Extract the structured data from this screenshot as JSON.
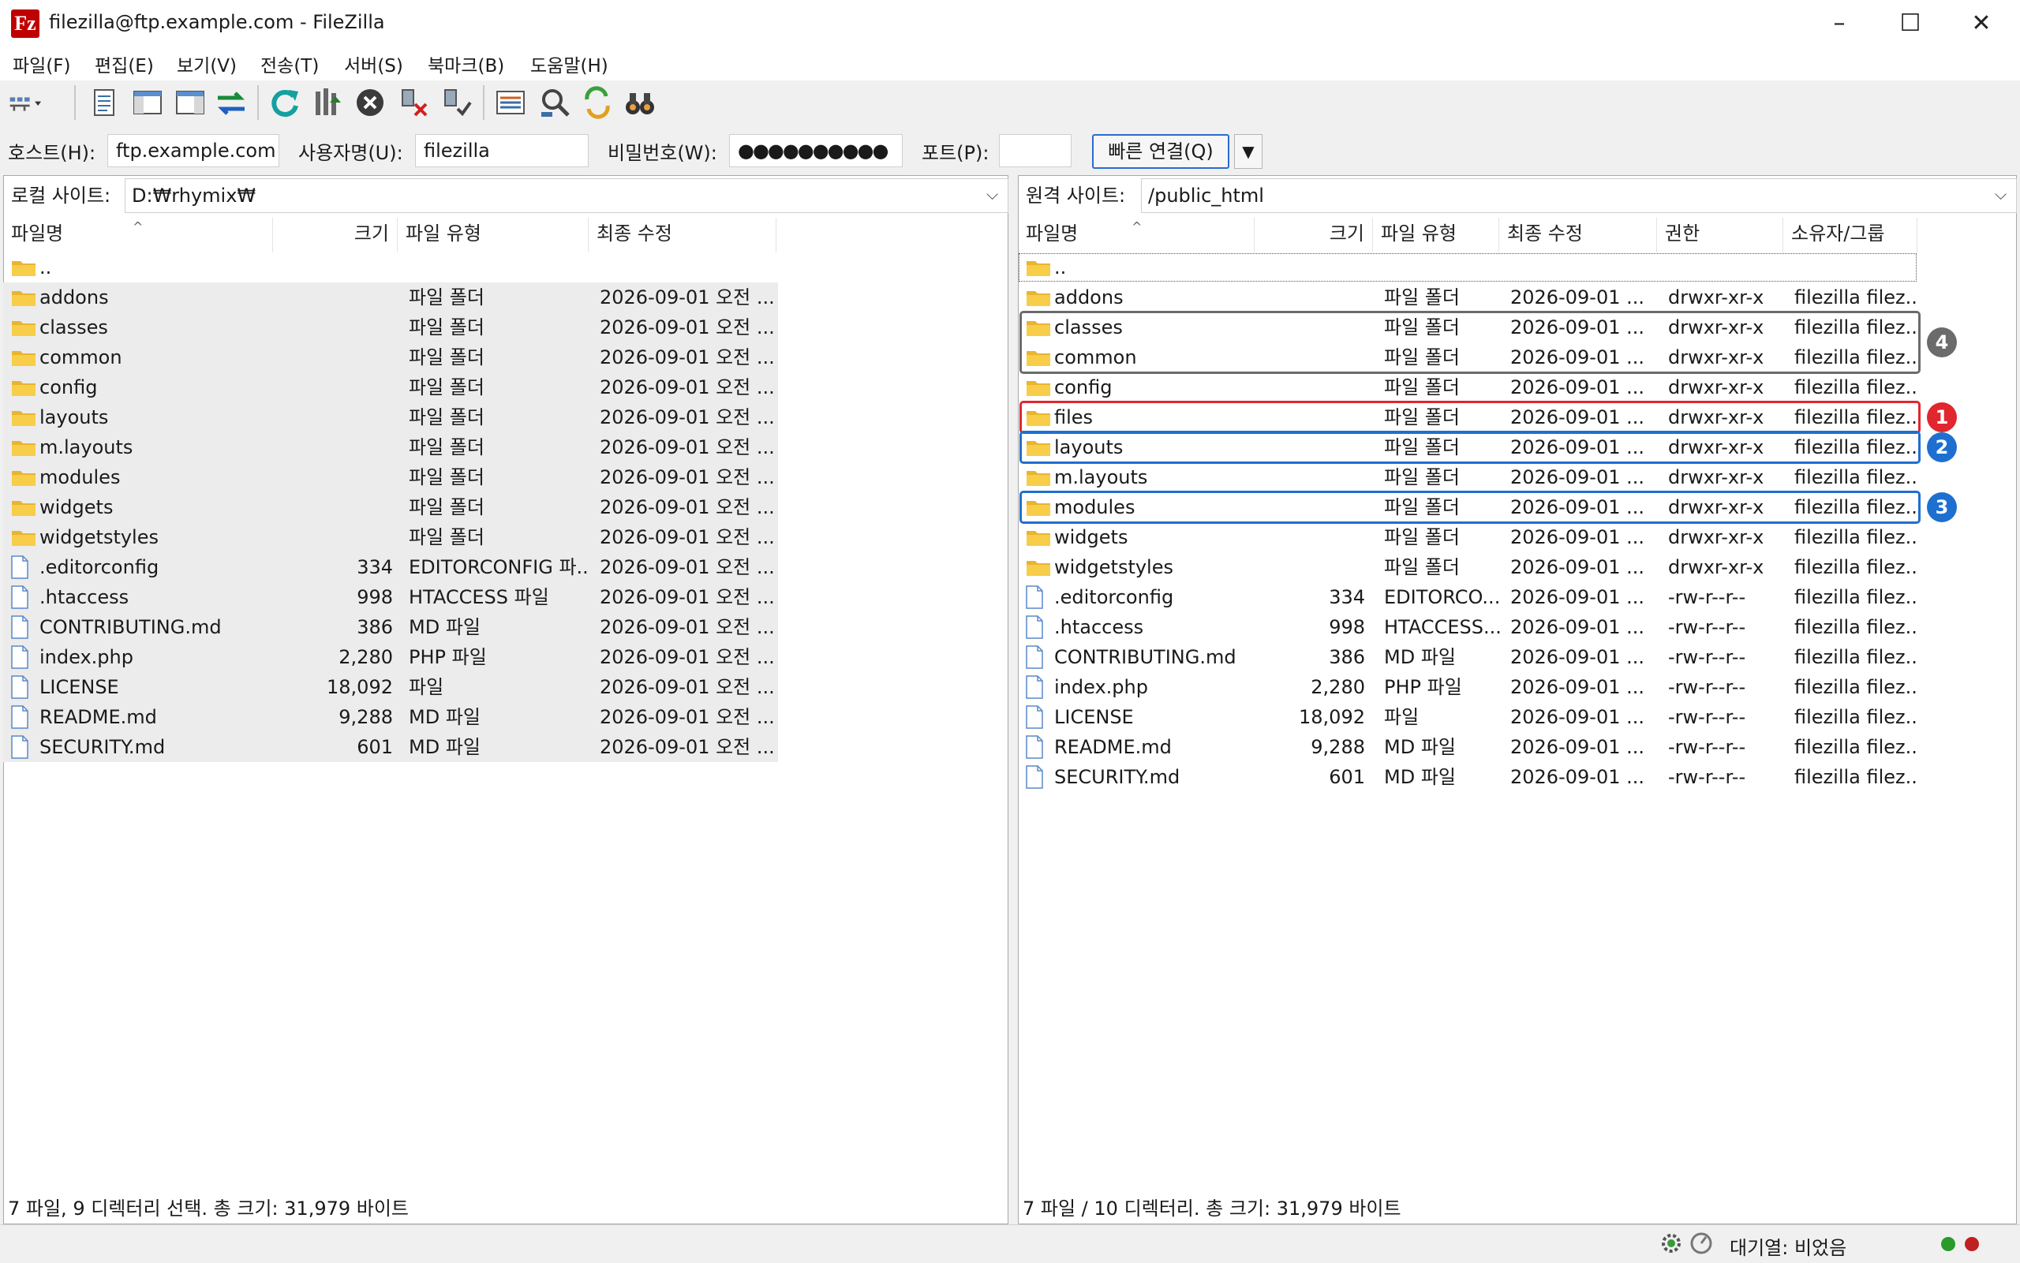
{
  "window": {
    "title": "filezilla@ftp.example.com - FileZilla",
    "app_icon": "Fz"
  },
  "menu": [
    "파일(F)",
    "편집(E)",
    "보기(V)",
    "전송(T)",
    "서버(S)",
    "북마크(B)",
    "도움말(H)"
  ],
  "toolbar": [
    "site-manager",
    "toggle-log",
    "toggle-local-tree",
    "toggle-remote-tree",
    "toggle-queue",
    "refresh",
    "process-queue",
    "cancel",
    "disconnect",
    "reconnect",
    "directory-listing-filters",
    "directory-comparison",
    "synchronized-browsing",
    "search"
  ],
  "quickconnect": {
    "host_label": "호스트(H):",
    "host_value": "ftp.example.com",
    "user_label": "사용자명(U):",
    "user_value": "filezilla",
    "pass_label": "비밀번호(W):",
    "pass_value": "●●●●●●●●●●",
    "port_label": "포트(P):",
    "port_value": "",
    "button": "빠른 연결(Q)",
    "dropdown": "▼"
  },
  "local": {
    "site_label": "로컬 사이트:",
    "path": "D:₩rhymix₩",
    "columns": [
      "파일명",
      "크기",
      "파일 유형",
      "최종 수정"
    ],
    "rows": [
      {
        "name": "..",
        "size": "",
        "type": "",
        "modified": "",
        "kind": "folder"
      },
      {
        "name": "addons",
        "size": "",
        "type": "파일 폴더",
        "modified": "2026-09-01 오전 ...",
        "kind": "folder"
      },
      {
        "name": "classes",
        "size": "",
        "type": "파일 폴더",
        "modified": "2026-09-01 오전 ...",
        "kind": "folder"
      },
      {
        "name": "common",
        "size": "",
        "type": "파일 폴더",
        "modified": "2026-09-01 오전 ...",
        "kind": "folder"
      },
      {
        "name": "config",
        "size": "",
        "type": "파일 폴더",
        "modified": "2026-09-01 오전 ...",
        "kind": "folder"
      },
      {
        "name": "layouts",
        "size": "",
        "type": "파일 폴더",
        "modified": "2026-09-01 오전 ...",
        "kind": "folder"
      },
      {
        "name": "m.layouts",
        "size": "",
        "type": "파일 폴더",
        "modified": "2026-09-01 오전 ...",
        "kind": "folder"
      },
      {
        "name": "modules",
        "size": "",
        "type": "파일 폴더",
        "modified": "2026-09-01 오전 ...",
        "kind": "folder"
      },
      {
        "name": "widgets",
        "size": "",
        "type": "파일 폴더",
        "modified": "2026-09-01 오전 ...",
        "kind": "folder"
      },
      {
        "name": "widgetstyles",
        "size": "",
        "type": "파일 폴더",
        "modified": "2026-09-01 오전 ...",
        "kind": "folder"
      },
      {
        "name": ".editorconfig",
        "size": "334",
        "type": "EDITORCONFIG 파...",
        "modified": "2026-09-01 오전 ...",
        "kind": "file"
      },
      {
        "name": ".htaccess",
        "size": "998",
        "type": "HTACCESS 파일",
        "modified": "2026-09-01 오전 ...",
        "kind": "file"
      },
      {
        "name": "CONTRIBUTING.md",
        "size": "386",
        "type": "MD 파일",
        "modified": "2026-09-01 오전 ...",
        "kind": "file"
      },
      {
        "name": "index.php",
        "size": "2,280",
        "type": "PHP 파일",
        "modified": "2026-09-01 오전 ...",
        "kind": "file"
      },
      {
        "name": "LICENSE",
        "size": "18,092",
        "type": "파일",
        "modified": "2026-09-01 오전 ...",
        "kind": "file"
      },
      {
        "name": "README.md",
        "size": "9,288",
        "type": "MD 파일",
        "modified": "2026-09-01 오전 ...",
        "kind": "file"
      },
      {
        "name": "SECURITY.md",
        "size": "601",
        "type": "MD 파일",
        "modified": "2026-09-01 오전 ...",
        "kind": "file"
      }
    ],
    "status": "7 파일, 9 디렉터리 선택. 총 크기: 31,979 바이트"
  },
  "remote": {
    "site_label": "원격 사이트:",
    "path": "/public_html",
    "columns": [
      "파일명",
      "크기",
      "파일 유형",
      "최종 수정",
      "권한",
      "소유자/그룹"
    ],
    "rows": [
      {
        "name": "..",
        "size": "",
        "type": "",
        "modified": "",
        "perm": "",
        "owner": "",
        "kind": "folder"
      },
      {
        "name": "addons",
        "size": "",
        "type": "파일 폴더",
        "modified": "2026-09-01 ...",
        "perm": "drwxr-xr-x",
        "owner": "filezilla filez...",
        "kind": "folder"
      },
      {
        "name": "classes",
        "size": "",
        "type": "파일 폴더",
        "modified": "2026-09-01 ...",
        "perm": "drwxr-xr-x",
        "owner": "filezilla filez...",
        "kind": "folder"
      },
      {
        "name": "common",
        "size": "",
        "type": "파일 폴더",
        "modified": "2026-09-01 ...",
        "perm": "drwxr-xr-x",
        "owner": "filezilla filez...",
        "kind": "folder"
      },
      {
        "name": "config",
        "size": "",
        "type": "파일 폴더",
        "modified": "2026-09-01 ...",
        "perm": "drwxr-xr-x",
        "owner": "filezilla filez...",
        "kind": "folder"
      },
      {
        "name": "files",
        "size": "",
        "type": "파일 폴더",
        "modified": "2026-09-01 ...",
        "perm": "drwxr-xr-x",
        "owner": "filezilla filez...",
        "kind": "folder"
      },
      {
        "name": "layouts",
        "size": "",
        "type": "파일 폴더",
        "modified": "2026-09-01 ...",
        "perm": "drwxr-xr-x",
        "owner": "filezilla filez...",
        "kind": "folder"
      },
      {
        "name": "m.layouts",
        "size": "",
        "type": "파일 폴더",
        "modified": "2026-09-01 ...",
        "perm": "drwxr-xr-x",
        "owner": "filezilla filez...",
        "kind": "folder"
      },
      {
        "name": "modules",
        "size": "",
        "type": "파일 폴더",
        "modified": "2026-09-01 ...",
        "perm": "drwxr-xr-x",
        "owner": "filezilla filez...",
        "kind": "folder"
      },
      {
        "name": "widgets",
        "size": "",
        "type": "파일 폴더",
        "modified": "2026-09-01 ...",
        "perm": "drwxr-xr-x",
        "owner": "filezilla filez...",
        "kind": "folder"
      },
      {
        "name": "widgetstyles",
        "size": "",
        "type": "파일 폴더",
        "modified": "2026-09-01 ...",
        "perm": "drwxr-xr-x",
        "owner": "filezilla filez...",
        "kind": "folder"
      },
      {
        "name": ".editorconfig",
        "size": "334",
        "type": "EDITORCO...",
        "modified": "2026-09-01 ...",
        "perm": "-rw-r--r--",
        "owner": "filezilla filez...",
        "kind": "file"
      },
      {
        "name": ".htaccess",
        "size": "998",
        "type": "HTACCESS...",
        "modified": "2026-09-01 ...",
        "perm": "-rw-r--r--",
        "owner": "filezilla filez...",
        "kind": "file"
      },
      {
        "name": "CONTRIBUTING.md",
        "size": "386",
        "type": "MD 파일",
        "modified": "2026-09-01 ...",
        "perm": "-rw-r--r--",
        "owner": "filezilla filez...",
        "kind": "file"
      },
      {
        "name": "index.php",
        "size": "2,280",
        "type": "PHP 파일",
        "modified": "2026-09-01 ...",
        "perm": "-rw-r--r--",
        "owner": "filezilla filez...",
        "kind": "file"
      },
      {
        "name": "LICENSE",
        "size": "18,092",
        "type": "파일",
        "modified": "2026-09-01 ...",
        "perm": "-rw-r--r--",
        "owner": "filezilla filez...",
        "kind": "file"
      },
      {
        "name": "README.md",
        "size": "9,288",
        "type": "MD 파일",
        "modified": "2026-09-01 ...",
        "perm": "-rw-r--r--",
        "owner": "filezilla filez...",
        "kind": "file"
      },
      {
        "name": "SECURITY.md",
        "size": "601",
        "type": "MD 파일",
        "modified": "2026-09-01 ...",
        "perm": "-rw-r--r--",
        "owner": "filezilla filez...",
        "kind": "file"
      }
    ],
    "status": "7 파일 / 10 디렉터리. 총 크기: 31,979 바이트"
  },
  "annotations": [
    {
      "label": "4",
      "rows": [
        "classes",
        "common"
      ],
      "color": "#6b6b6b"
    },
    {
      "label": "1",
      "rows": [
        "files"
      ],
      "color": "#e0262e"
    },
    {
      "label": "2",
      "rows": [
        "layouts"
      ],
      "color": "#1e6fd0"
    },
    {
      "label": "3",
      "rows": [
        "modules"
      ],
      "color": "#1e6fd0"
    }
  ],
  "bottom_status": {
    "queue": "대기열: 비었음"
  }
}
